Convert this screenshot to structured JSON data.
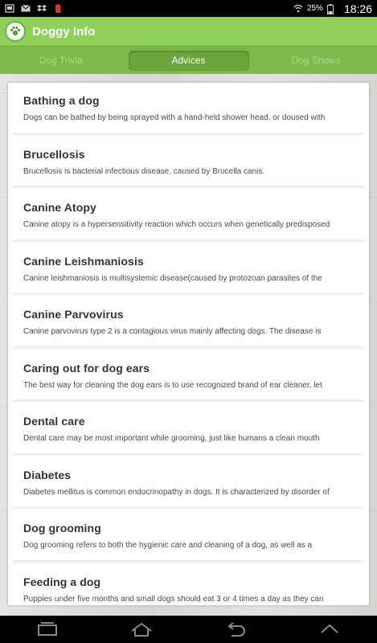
{
  "status_bar": {
    "battery_percent": "25%",
    "time": "18:26"
  },
  "app": {
    "title": "Doggy Info"
  },
  "tabs": [
    {
      "label": "Dog Trivia"
    },
    {
      "label": "Advices"
    },
    {
      "label": "Dog Shows"
    }
  ],
  "advices": [
    {
      "title": "Bathing a dog",
      "desc": "Dogs can be bathed by being sprayed with a hand-held shower head, or doused with"
    },
    {
      "title": "Brucellosis",
      "desc": "Brucellosis is bacterial infectious disease, caused by Brucella canis."
    },
    {
      "title": "Canine Atopy",
      "desc": "Canine atopy is a hypersensitivity reaction which occurs when genetically predisposed"
    },
    {
      "title": "Canine Leishmaniosis",
      "desc": "Canine leishmaniosis is multisystemic disease(caused by protozoan parasites of the"
    },
    {
      "title": "Canine Parvovirus",
      "desc": "Canine parvovirus type 2 is a contagious virus  mainly affecting dogs. The disease is"
    },
    {
      "title": "Caring out for dog ears",
      "desc": "The best way for  cleaning the dog ears is to use recognized brand of ear cleaner, let"
    },
    {
      "title": "Dental care",
      "desc": "Dental care may be most important while grooming, just like humans a clean mouth"
    },
    {
      "title": "Diabetes",
      "desc": "Diabetes mellitus is common endocrinopathy in dogs. It is characterized by disorder of"
    },
    {
      "title": "Dog grooming",
      "desc": "Dog grooming refers to both the hygienic care and cleaning of a dog, as well as a"
    },
    {
      "title": "Feeding a dog",
      "desc": "Puppies under five months and small dogs should eat 3 or 4 times a day as they can"
    }
  ],
  "colors": {
    "app_bar": "#8fd05b",
    "tab_bar": "#7dba4b",
    "active_tab": "#6aa63b"
  },
  "icons": {
    "status_left": [
      "notification-icon",
      "mail-icon",
      "dropbox-icon",
      "battery-alert-icon"
    ],
    "status_right": [
      "wifi-icon",
      "battery-icon"
    ],
    "nav": [
      "recent-apps-icon",
      "home-icon",
      "back-icon",
      "menu-up-icon"
    ]
  }
}
